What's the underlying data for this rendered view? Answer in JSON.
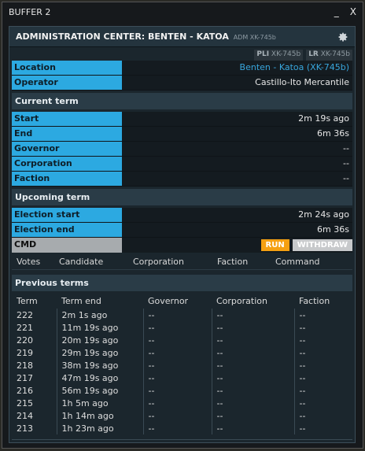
{
  "window": {
    "title": "BUFFER 2",
    "minimize": "_",
    "close": "X"
  },
  "panel": {
    "title": "ADMINISTRATION CENTER: BENTEN - KATOA",
    "subtitle": "ADM XK-745b",
    "chips": [
      {
        "tag": "PLI",
        "text": "XK-745b"
      },
      {
        "tag": "LR",
        "text": "XK-745b"
      }
    ]
  },
  "info": {
    "location_label": "Location",
    "location_value": "Benten - Katoa (XK-745b)",
    "operator_label": "Operator",
    "operator_value": "Castillo-Ito Mercantile"
  },
  "current_term": {
    "heading": "Current term",
    "rows": [
      {
        "label": "Start",
        "value": "2m 19s ago"
      },
      {
        "label": "End",
        "value": "6m 36s"
      },
      {
        "label": "Governor",
        "value": "--"
      },
      {
        "label": "Corporation",
        "value": "--"
      },
      {
        "label": "Faction",
        "value": "--"
      }
    ]
  },
  "upcoming_term": {
    "heading": "Upcoming term",
    "rows": [
      {
        "label": "Election start",
        "value": "2m 24s ago"
      },
      {
        "label": "Election end",
        "value": "6m 36s"
      }
    ],
    "cmd_label": "CMD",
    "run_label": "RUN",
    "withdraw_label": "WITHDRAW",
    "columns": [
      "Votes",
      "Candidate",
      "Corporation",
      "Faction",
      "Command"
    ]
  },
  "previous_terms": {
    "heading": "Previous terms",
    "columns": [
      "Term",
      "Term end",
      "Governor",
      "Corporation",
      "Faction"
    ],
    "rows": [
      [
        "222",
        "2m 1s ago",
        "--",
        "--",
        "--"
      ],
      [
        "221",
        "11m 19s ago",
        "--",
        "--",
        "--"
      ],
      [
        "220",
        "20m 19s ago",
        "--",
        "--",
        "--"
      ],
      [
        "219",
        "29m 19s ago",
        "--",
        "--",
        "--"
      ],
      [
        "218",
        "38m 19s ago",
        "--",
        "--",
        "--"
      ],
      [
        "217",
        "47m 19s ago",
        "--",
        "--",
        "--"
      ],
      [
        "216",
        "56m 19s ago",
        "--",
        "--",
        "--"
      ],
      [
        "215",
        "1h 5m ago",
        "--",
        "--",
        "--"
      ],
      [
        "214",
        "1h 14m ago",
        "--",
        "--",
        "--"
      ],
      [
        "213",
        "1h 23m ago",
        "--",
        "--",
        "--"
      ]
    ]
  }
}
